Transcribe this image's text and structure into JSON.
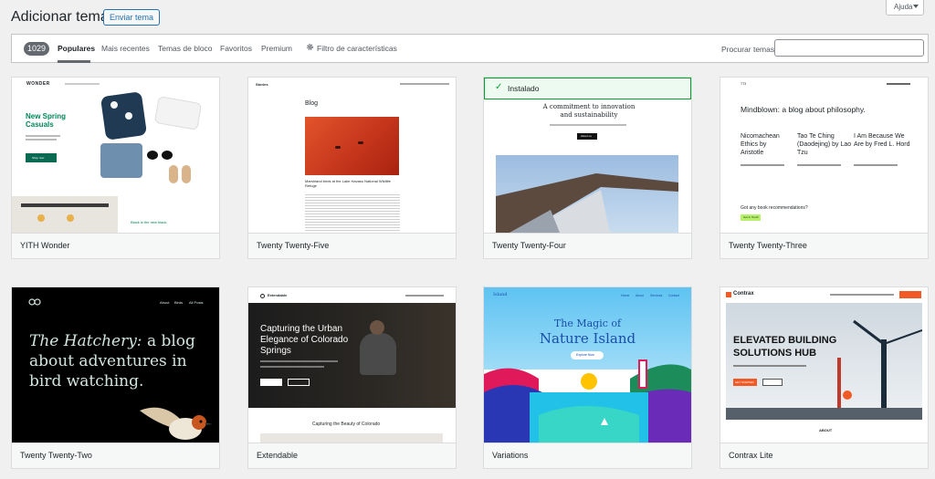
{
  "header": {
    "title": "Adicionar temas",
    "upload_label": "Enviar tema",
    "help_label": "Ajuda"
  },
  "filter": {
    "count": "1029",
    "tabs": [
      "Populares",
      "Mais recentes",
      "Temas de bloco",
      "Favoritos",
      "Premium"
    ],
    "feature_filter": "Filtro de características",
    "search_label": "Procurar temas",
    "search_value": ""
  },
  "themes": [
    {
      "name": "YITH Wonder",
      "preview": {
        "logo": "WONDER",
        "headline": "New Spring Casuals",
        "button": "Shop now",
        "footer": "Black is the new black."
      }
    },
    {
      "name": "Twenty Twenty-Five",
      "preview": {
        "logo": "Stories",
        "heading": "Blog",
        "caption": "Marshland birds at the Lake Havasu National Wildlife Refuge"
      }
    },
    {
      "name": "Twenty Twenty-Four",
      "installed": "Instalado",
      "preview": {
        "headline": "A commitment to innovation and sustainability",
        "button": "About us"
      }
    },
    {
      "name": "Twenty Twenty-Three",
      "preview": {
        "logo": "TT3",
        "headline": "Mindblown: a blog about philosophy.",
        "posts": [
          "Nicomachean Ethics by Aristotle",
          "Tao Te Ching (Daodejing) by Lao Tzu",
          "I Am Because We Are by Fred L. Hord"
        ],
        "question": "Got any book recommendations?",
        "button": "Get In Touch"
      }
    },
    {
      "name": "Twenty Twenty-Two",
      "preview": {
        "nav": [
          "About",
          "Birds",
          "All Posts"
        ],
        "headline_italic": "The Hatchery:",
        "headline_rest": "a blog about adventures in bird watching."
      }
    },
    {
      "name": "Extendable",
      "preview": {
        "logo": "Extendable",
        "headline": "Capturing the Urban Elegance of Colorado Springs",
        "subheading": "Capturing the Beauty of Colorado"
      }
    },
    {
      "name": "Variations",
      "preview": {
        "logo": "Island",
        "nav": [
          "Home",
          "About",
          "Services",
          "Contact"
        ],
        "headline_1": "The Magic of",
        "headline_2": "Nature Island",
        "button": "Explore Now"
      }
    },
    {
      "name": "Contrax Lite",
      "preview": {
        "logo": "Contrax",
        "headline_1": "ELEVATED BUILDING",
        "headline_2": "SOLUTIONS HUB",
        "button": "GET STARTED",
        "about": "ABOUT"
      }
    }
  ],
  "colors": {
    "accent": "#2271b1",
    "installed_bg": "#edfaef",
    "installed_border": "#00a32a",
    "contrax_orange": "#f15a24",
    "variations_blue": "#1a4ea8"
  }
}
